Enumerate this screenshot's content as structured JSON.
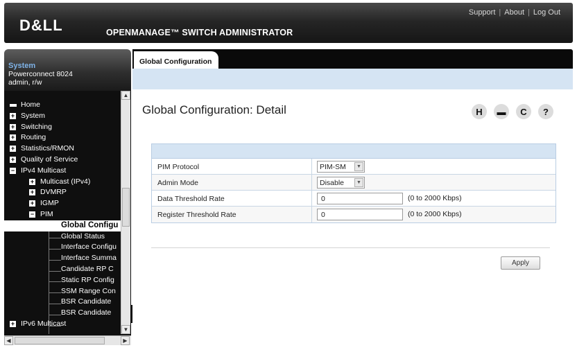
{
  "header": {
    "logo": "D&LL",
    "app_title": "OPENMANAGE™ SWITCH ADMINISTRATOR",
    "links": [
      "Support",
      "About",
      "Log Out"
    ],
    "link_separator": "|"
  },
  "system": {
    "title": "System",
    "model": "Powerconnect 8024",
    "user": "admin, r/w"
  },
  "nav": {
    "items": [
      {
        "label": "Home"
      },
      {
        "label": "System"
      },
      {
        "label": "Switching"
      },
      {
        "label": "Routing"
      },
      {
        "label": "Statistics/RMON"
      },
      {
        "label": "Quality of Service"
      },
      {
        "label": "IPv4 Multicast"
      },
      {
        "label": "Multicast (IPv4)"
      },
      {
        "label": "DVMRP"
      },
      {
        "label": "IGMP"
      },
      {
        "label": "PIM"
      },
      {
        "label": "Global Configu"
      },
      {
        "label": "Global Status"
      },
      {
        "label": "Interface Configu"
      },
      {
        "label": "Interface Summa"
      },
      {
        "label": "Candidate RP C"
      },
      {
        "label": "Static RP Config"
      },
      {
        "label": "SSM Range Con"
      },
      {
        "label": "BSR Candidate"
      },
      {
        "label": "BSR Candidate"
      },
      {
        "label": "IPv6 Multicast"
      }
    ]
  },
  "tabs": [
    {
      "label": "Global Configuration"
    }
  ],
  "page": {
    "title": "Global Configuration: Detail",
    "toolbar_icons": [
      "save-icon",
      "print-icon",
      "refresh-icon",
      "help-icon"
    ],
    "toolbar_glyphs": [
      "H",
      "▬",
      "C",
      "?"
    ]
  },
  "form": {
    "rows": [
      {
        "label": "PIM Protocol",
        "type": "select",
        "value": "PIM-SM"
      },
      {
        "label": "Admin Mode",
        "type": "select",
        "value": "Disable"
      },
      {
        "label": "Data Threshold Rate",
        "type": "text",
        "value": "0",
        "range": "(0 to 2000 Kbps)"
      },
      {
        "label": "Register Threshold Rate",
        "type": "text",
        "value": "0",
        "range": "(0 to 2000 Kbps)"
      }
    ],
    "apply_label": "Apply"
  },
  "colors": {
    "accent_blue": "#d5e4f3",
    "sidebar_bg": "#0f0f0f",
    "system_title": "#7fb3e8"
  }
}
